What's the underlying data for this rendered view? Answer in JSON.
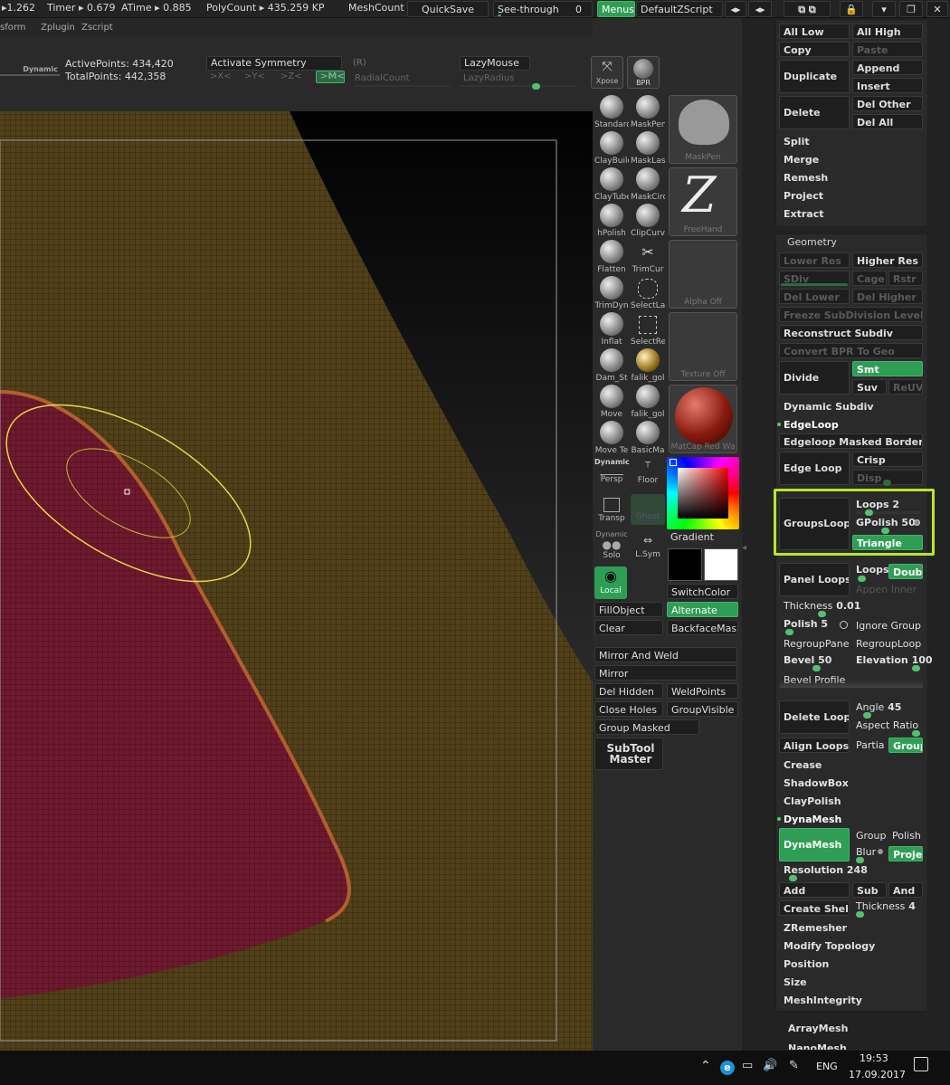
{
  "statusbar": {
    "timer_prefix": "▸1.262",
    "timer_label": "Timer ▸ 0.679",
    "atime_label": "ATime ▸ 0.885",
    "polycount": "PolyCount ▸ 435.259  KP",
    "meshcount": "MeshCount",
    "quicksave": "QuickSave",
    "see_through": "See-through",
    "see_through_value": "0",
    "menus": "Menus",
    "script": "DefaultZScript"
  },
  "menubar": [
    "sform",
    "Zplugin",
    "Zscript"
  ],
  "infobar": {
    "dynamic": "Dynamic",
    "active_points": "ActivePoints: 434,420",
    "total_points": "TotalPoints: 442,358",
    "activate_symmetry": "Activate Symmetry",
    "r": "(R)",
    "axes": [
      ">X<",
      ">Y<",
      ">Z<",
      ">M<"
    ],
    "radial_count": "RadialCount",
    "lazymouse": "LazyMouse",
    "lazyradius": "LazyRadius",
    "xpose": "Xpose",
    "bpr": "BPR"
  },
  "brushes": [
    {
      "a": "Standard",
      "b": "MaskPen"
    },
    {
      "a": "ClayBuild",
      "b": "MaskLas"
    },
    {
      "a": "ClayTube",
      "b": "MaskCirc"
    },
    {
      "a": "hPolish",
      "b": "ClipCurv"
    },
    {
      "a": "Flatten",
      "b": "TrimCur"
    },
    {
      "a": "TrimDyn",
      "b": "SelectLa"
    },
    {
      "a": "Inflat",
      "b": "SelectRe"
    },
    {
      "a": "Dam_St",
      "b": "falik_gol"
    },
    {
      "a": "Move",
      "b": "falik_gol"
    },
    {
      "a": "Move Te",
      "b": "BasicMa"
    }
  ],
  "previews": {
    "maskpen": "MaskPen",
    "freehand": "FreeHand",
    "alpha": "Alpha  Off",
    "texture": "Texture  Off",
    "matcap": "MatCap  Red  Wa"
  },
  "midtools": {
    "dynamic": "Dynamic",
    "persp": "Persp",
    "floor": "Floor",
    "transp": "Transp",
    "ghost": "Ghost",
    "dyn2": "Dynamic",
    "solo": "Solo",
    "lsym": "L.Sym",
    "local": "Local",
    "gradient": "Gradient",
    "switchcolor": "SwitchColor",
    "fillobject": "FillObject",
    "alternate": "Alternate",
    "clear": "Clear",
    "backface": "BackfaceMas"
  },
  "subtool_mid": {
    "mirror_weld": "Mirror And Weld",
    "mirror": "Mirror",
    "del_hidden": "Del Hidden",
    "weldpoints": "WeldPoints",
    "close_holes": "Close Holes",
    "groupvisible": "GroupVisible",
    "group_masked": "Group Masked",
    "subtool_master": "SubTool\nMaster"
  },
  "subtool": {
    "all_low": "All Low",
    "all_high": "All High",
    "copy": "Copy",
    "paste": "Paste",
    "duplicate": "Duplicate",
    "append": "Append",
    "insert": "Insert",
    "delete": "Delete",
    "del_other": "Del Other",
    "del_all": "Del All",
    "items": [
      "Split",
      "Merge",
      "Remesh",
      "Project",
      "Extract"
    ]
  },
  "geometry": {
    "title": "Geometry",
    "lower_res": "Lower Res",
    "higher_res": "Higher Res",
    "sdiv": "SDiv",
    "cage": "Cage",
    "rstr": "Rstr",
    "del_lower": "Del Lower",
    "del_higher": "Del Higher",
    "freeze": "Freeze SubDivision Levels",
    "reconstruct": "Reconstruct Subdiv",
    "convert_bpr": "Convert BPR To Geo",
    "divide": "Divide",
    "smt": "Smt",
    "suv": "Suv",
    "reuv": "ReUV",
    "dynamic_subdiv": "Dynamic Subdiv",
    "edgeloop": "EdgeLoop",
    "edgeloop_masked": "Edgeloop Masked Border",
    "edge_loop": "Edge Loop",
    "crisp": "Crisp",
    "disp": "Disp",
    "groupsloops": "GroupsLoops",
    "loops": "Loops",
    "loops_val": "2",
    "gpolish": "GPolish",
    "gpolish_val": "50",
    "triangle": "Triangle",
    "panel_loops": "Panel Loops",
    "loops2": "Loops",
    "double": "Double",
    "append_inner": "Appen Inner",
    "thickness": "Thickness",
    "thickness_val": "0.01",
    "polish": "Polish",
    "polish_val": "5",
    "ignore_groups": "Ignore Group",
    "regroup_panel": "RegroupPane",
    "regroup_loops": "RegroupLoop",
    "bevel": "Bevel",
    "bevel_val": "50",
    "elevation": "Elevation",
    "elevation_val": "100",
    "bevel_profile": "Bevel Profile",
    "delete_loops": "Delete Loops",
    "angle": "Angle",
    "angle_val": "45",
    "aspect_ratio": "Aspect Ratio",
    "align_loops": "Align Loops",
    "partial": "Partia",
    "groups": "Group",
    "crease": "Crease",
    "shadowbox": "ShadowBox",
    "claypolish": "ClayPolish",
    "dynamesh_title": "DynaMesh",
    "dynamesh": "DynaMesh",
    "group": "Group",
    "polish2": "Polish",
    "blur": "Blur",
    "project": "Proje",
    "resolution": "Resolution",
    "resolution_val": "248",
    "add": "Add",
    "sub": "Sub",
    "and": "And",
    "create_shell": "Create Shell",
    "thickness2": "Thickness",
    "thickness2_val": "4",
    "zremesher": "ZRemesher",
    "modify_topology": "Modify Topology",
    "position": "Position",
    "size": "Size",
    "meshintegrity": "MeshIntegrity",
    "arraymesh": "ArrayMesh",
    "nanomesh": "NanoMesh"
  },
  "taskbar": {
    "lang": "ENG",
    "time": "19:53",
    "date": "17.09.2017"
  }
}
